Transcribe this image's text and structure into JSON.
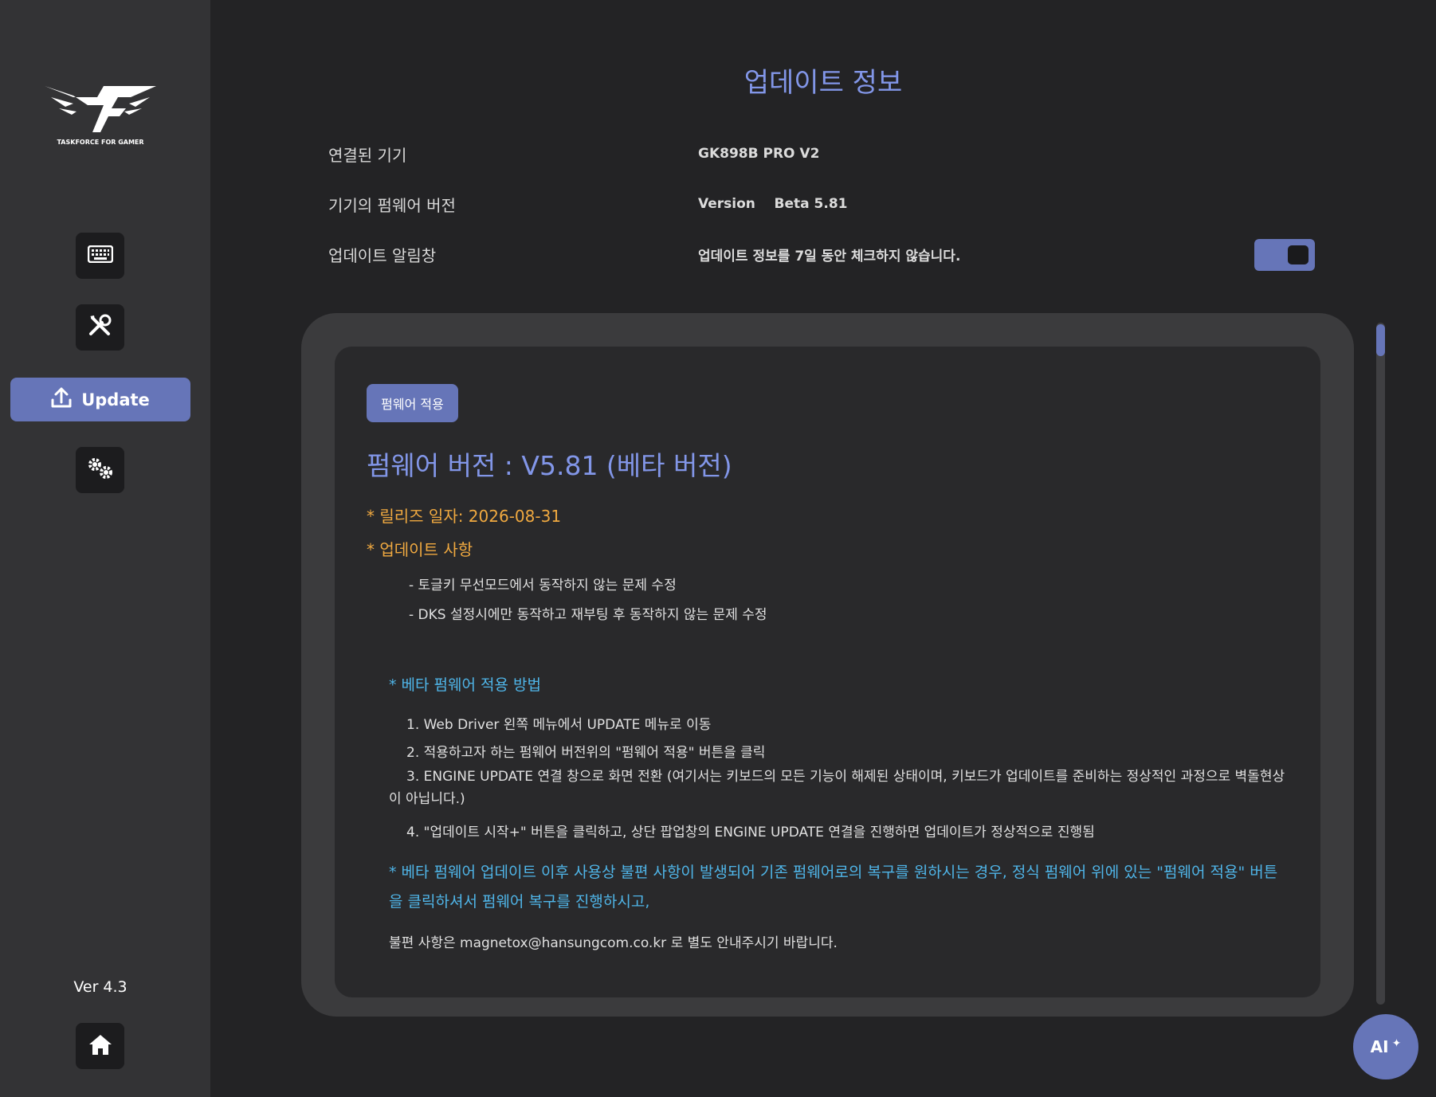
{
  "sidebar": {
    "logo_text": "TASKFORCE FOR GAMER",
    "items": [
      {
        "icon": "keyboard-icon"
      },
      {
        "icon": "tools-icon"
      },
      {
        "icon": "upload-icon",
        "label": "Update"
      },
      {
        "icon": "gears-icon"
      }
    ],
    "version": "Ver 4.3",
    "home_icon": "home-icon"
  },
  "header": {
    "title": "업데이트 정보",
    "rows": [
      {
        "label": "연결된 기기",
        "value": "GK898B PRO V2"
      },
      {
        "label": "기기의 펌웨어 버전",
        "value": "Version    Beta 5.81"
      },
      {
        "label": "업데이트 알림창",
        "value": "업데이트 정보를 7일 동안 체크하지 않습니다."
      }
    ],
    "toggle_on": true
  },
  "card": {
    "apply_button": "펌웨어 적용",
    "firmware_title": "펌웨어 버전 : V5.81 (베타 버전)",
    "release_date": "* 릴리즈 일자: 2026-08-31",
    "update_heading": "* 업데이트 사항",
    "update_items": [
      "- 토글키 무선모드에서 동작하지 않는 문제 수정",
      "- DKS 설정시에만 동작하고 재부팅 후 동작하지 않는 문제 수정"
    ],
    "method_heading": "* 베타 펌웨어 적용 방법",
    "steps": [
      "1. Web Driver 왼쪽 메뉴에서 UPDATE 메뉴로 이동",
      "2. 적용하고자 하는 펌웨어 버전위의 \"펌웨어 적용\" 버튼을 클릭",
      "3. ENGINE UPDATE 연결 창으로 화면 전환 (여기서는 키보드의 모든 기능이 해제된 상태이며, 키보드가 업데이트를 준비하는 정상적인 과정으로 벽돌현상이 아닙니다.)",
      "4. \"업데이트 시작+\" 버튼을 클릭하고, 상단 팝업창의 ENGINE UPDATE 연결을 진행하면 업데이트가 정상적으로 진행됨"
    ],
    "recovery_note": "* 베타 펌웨어 업데이트 이후 사용상 불편 사항이 발생되어 기존 펌웨어로의 복구를 원하시는 경우, 정식 펌웨어 위에 있는 \"펌웨어 적용\" 버튼을 클릭하셔서 펌웨어 복구를 진행하시고,",
    "contact": "불편 사항은 magnetox@hansungcom.co.kr 로 별도 안내주시기 바랍니다."
  },
  "ai_button": {
    "label": "AI",
    "icon": "sparkle-icon"
  },
  "colors": {
    "accent": "#6675b8",
    "title_blue": "#8296e8",
    "orange": "#f0a940",
    "cyan": "#4fb5e8"
  }
}
